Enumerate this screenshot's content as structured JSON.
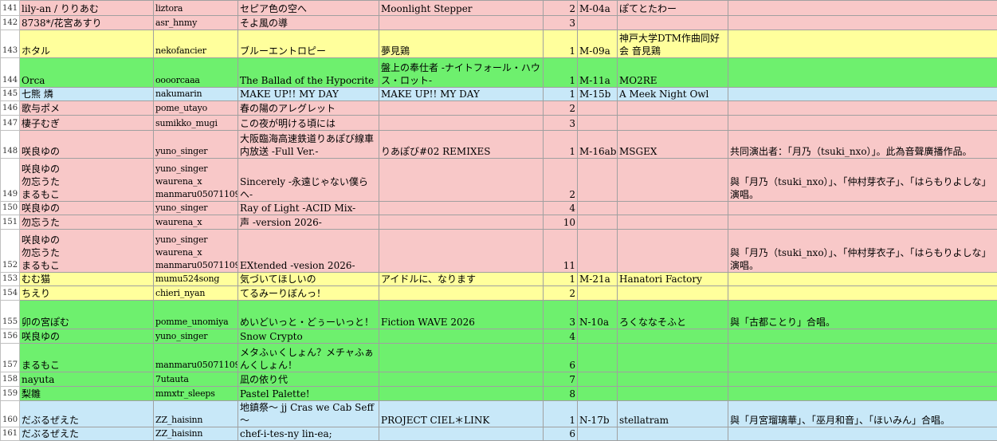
{
  "colors": {
    "pink": "#f8c8c8",
    "yellow": "#ffff9c",
    "green": "#6ef06e",
    "blue": "#c8e8f8"
  },
  "rows": [
    {
      "n": "141",
      "color": "pink",
      "h": 19,
      "artist": "lily-an / りりあむ",
      "id": "liztora",
      "title": "セピア色の空へ",
      "album": "Moonlight Stepper",
      "disc": "2",
      "booth": "M-04a",
      "circle": "ぽてとたわー",
      "note": ""
    },
    {
      "n": "142",
      "color": "pink",
      "h": 18,
      "artist": "8738*/花宮あすり",
      "id": "asr_hnmy",
      "title": "そよ風の導",
      "album": "",
      "disc": "3",
      "booth": "",
      "circle": "",
      "note": ""
    },
    {
      "n": "143",
      "color": "yellow",
      "h": 35,
      "artist": "ホタル",
      "id": "nekofancier",
      "title": "ブルーエントロピー",
      "album": "夢見鶏",
      "disc": "1",
      "booth": "M-09a",
      "circle": "神戸大学DTM作曲同好会 音見鶏",
      "note": ""
    },
    {
      "n": "144",
      "color": "green",
      "h": 37,
      "artist": "Orca",
      "id": "oooorcaaa",
      "title": "The Ballad of the Hypocrite",
      "album": "盤上の奉仕者 -ナイトフォール・ハウス・ロット-",
      "disc": "1",
      "booth": "M-11a",
      "circle": "MO2RE",
      "note": ""
    },
    {
      "n": "145",
      "color": "blue",
      "h": 17,
      "artist": "七熊 燐",
      "id": "nakumarin",
      "title": "MAKE UP!! MY DAY",
      "album": "MAKE UP!! MY DAY",
      "disc": "1",
      "booth": "M-15b",
      "circle": "A Meek Night Owl",
      "note": ""
    },
    {
      "n": "146",
      "color": "pink",
      "h": 18,
      "artist": "歌与ポメ",
      "id": "pome_utayo",
      "title": "春の陽のアレグレット",
      "album": "",
      "disc": "2",
      "booth": "",
      "circle": "",
      "note": ""
    },
    {
      "n": "147",
      "color": "pink",
      "h": 19,
      "artist": "棲子むぎ",
      "id": "sumikko_mugi",
      "title": "この夜が明ける頃には",
      "album": "",
      "disc": "3",
      "booth": "",
      "circle": "",
      "note": ""
    },
    {
      "n": "148",
      "color": "pink",
      "h": 35,
      "artist": "咲良ゆの",
      "id": "yuno_singer",
      "title": "大阪臨海高速鉄道りあぽび線車内放送 -Full Ver.-",
      "album": "りあぽび#02 REMIXES",
      "disc": "1",
      "booth": "M-16ab",
      "circle": "MSGEX",
      "note": "共同演出者：「月乃（tsuki_nxo）」。此為音聲廣播作品。"
    },
    {
      "n": "149",
      "color": "pink",
      "h": 54,
      "artist": "咲良ゆの\n勿忘うた\nまるもこ",
      "id": "yuno_singer\nwaurena_x\nmanmaru05071109",
      "title": "Sincerely -永遠じゃない僕らへ-",
      "album": "",
      "disc": "2",
      "booth": "",
      "circle": "",
      "note": "與「月乃（tsuki_nxo）」、「仲村芽衣子」、「はらもりよしな」演唱。"
    },
    {
      "n": "150",
      "color": "pink",
      "h": 17,
      "artist": "咲良ゆの",
      "id": "yuno_singer",
      "title": "Ray of Light -ACID Mix-",
      "album": "",
      "disc": "4",
      "booth": "",
      "circle": "",
      "note": ""
    },
    {
      "n": "151",
      "color": "pink",
      "h": 18,
      "artist": "勿忘うた",
      "id": "waurena_x",
      "title": "声 -version 2026-",
      "album": "",
      "disc": "10",
      "booth": "",
      "circle": "",
      "note": ""
    },
    {
      "n": "152",
      "color": "pink",
      "h": 54,
      "artist": "咲良ゆの\n勿忘うた\nまるもこ",
      "id": "yuno_singer\nwaurena_x\nmanmaru05071109",
      "title": "EXtended -vesion 2026-",
      "album": "",
      "disc": "11",
      "booth": "",
      "circle": "",
      "note": "與「月乃（tsuki_nxo）」、「仲村芽衣子」、「はらもりよしな」演唱。"
    },
    {
      "n": "153",
      "color": "yellow",
      "h": 17,
      "artist": "むむ猫",
      "id": "mumu524song",
      "title": "気づいてほしいの",
      "album": "アイドルに、なります",
      "disc": "1",
      "booth": "M-21a",
      "circle": "Hanatori Factory",
      "note": ""
    },
    {
      "n": "154",
      "color": "yellow",
      "h": 18,
      "artist": "ちえり",
      "id": "chieri_nyan",
      "title": "てるみーりぼんっ！",
      "album": "",
      "disc": "2",
      "booth": "",
      "circle": "",
      "note": ""
    },
    {
      "n": "155",
      "color": "green",
      "h": 36,
      "artist": "卯の宮ぽむ",
      "id": "pomme_unomiya",
      "title": "めいどいっと・どぅーいっと！",
      "album": "Fiction WAVE 2026",
      "disc": "3",
      "booth": "N-10a",
      "circle": "ろくななそふと",
      "note": "與「古都ことり」合唱。"
    },
    {
      "n": "156",
      "color": "green",
      "h": 18,
      "artist": "咲良ゆの",
      "id": "yuno_singer",
      "title": "Snow Crypto",
      "album": "",
      "disc": "4",
      "booth": "",
      "circle": "",
      "note": ""
    },
    {
      "n": "157",
      "color": "green",
      "h": 36,
      "artist": "まるもこ",
      "id": "manmaru05071109",
      "title": "メタふぃくしょん？メチャふぁんくしょん！",
      "album": "",
      "disc": "6",
      "booth": "",
      "circle": "",
      "note": ""
    },
    {
      "n": "158",
      "color": "green",
      "h": 18,
      "artist": "nayuta",
      "id": "7utauta",
      "title": "凪の依り代",
      "album": "",
      "disc": "7",
      "booth": "",
      "circle": "",
      "note": ""
    },
    {
      "n": "159",
      "color": "green",
      "h": 18,
      "artist": "梨雛",
      "id": "mmxtr_sleeps",
      "title": "Pastel Palette!",
      "album": "",
      "disc": "8",
      "booth": "",
      "circle": "",
      "note": ""
    },
    {
      "n": "160",
      "color": "blue",
      "h": 19,
      "artist": "だぶるぜえた",
      "id": "ZZ_haisinn",
      "title": "地鎮祭〜 jj Cras we Cab Seff 〜",
      "album": "PROJECT CIEL＊LINK",
      "disc": "1",
      "booth": "N-17b",
      "circle": "stellatram",
      "note": "與「月宮瑠璃華」、「巫月和音」、「ほいみん」合唱。"
    },
    {
      "n": "161",
      "color": "blue",
      "h": 15,
      "artist": "だぶるぜえた",
      "id": "ZZ_haisinn",
      "title": "chef-i-tes-ny lin-ea;",
      "album": "",
      "disc": "6",
      "booth": "",
      "circle": "",
      "note": ""
    }
  ]
}
